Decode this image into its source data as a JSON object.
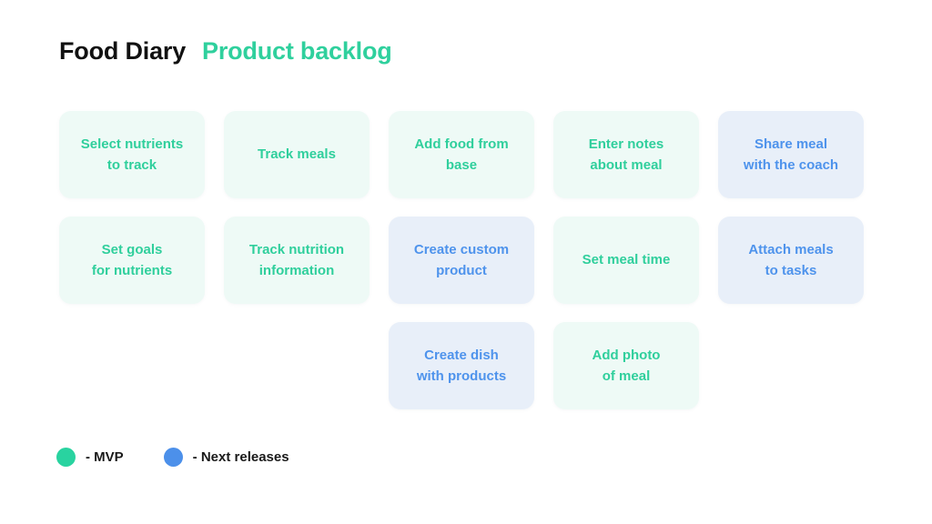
{
  "header": {
    "title": "Food Diary",
    "subtitle": "Product backlog"
  },
  "colors": {
    "mvp_accent": "#2FCF9C",
    "mvp_card_bg": "#EEFAF6",
    "next_accent": "#4E93EC",
    "next_card_bg": "#E8EFF9",
    "mvp_dot": "#29D3A0",
    "next_dot": "#4C90EA",
    "title_text": "#111111",
    "background": "#FFFFFF"
  },
  "board": {
    "rows": [
      {
        "cards": [
          {
            "label": "Select nutrients\nto track",
            "category": "mvp"
          },
          {
            "label": "Track meals",
            "category": "mvp"
          },
          {
            "label": "Add food from\nbase",
            "category": "mvp"
          },
          {
            "label": "Enter notes\nabout meal",
            "category": "mvp"
          },
          {
            "label": "Share meal\nwith the coach",
            "category": "next"
          }
        ]
      },
      {
        "cards": [
          {
            "label": "Set goals\nfor nutrients",
            "category": "mvp"
          },
          {
            "label": "Track nutrition\ninformation",
            "category": "mvp"
          },
          {
            "label": "Create custom\nproduct",
            "category": "next"
          },
          {
            "label": "Set meal time",
            "category": "mvp"
          },
          {
            "label": "Attach meals\nto tasks",
            "category": "next"
          }
        ]
      },
      {
        "cards": [
          {
            "label": "Create dish\nwith products",
            "category": "next",
            "column": 3
          },
          {
            "label": "Add photo\nof meal",
            "category": "mvp",
            "column": 4
          }
        ]
      }
    ]
  },
  "legend": {
    "items": [
      {
        "label": "- MVP",
        "category": "mvp"
      },
      {
        "label": "- Next releases",
        "category": "next"
      }
    ]
  }
}
